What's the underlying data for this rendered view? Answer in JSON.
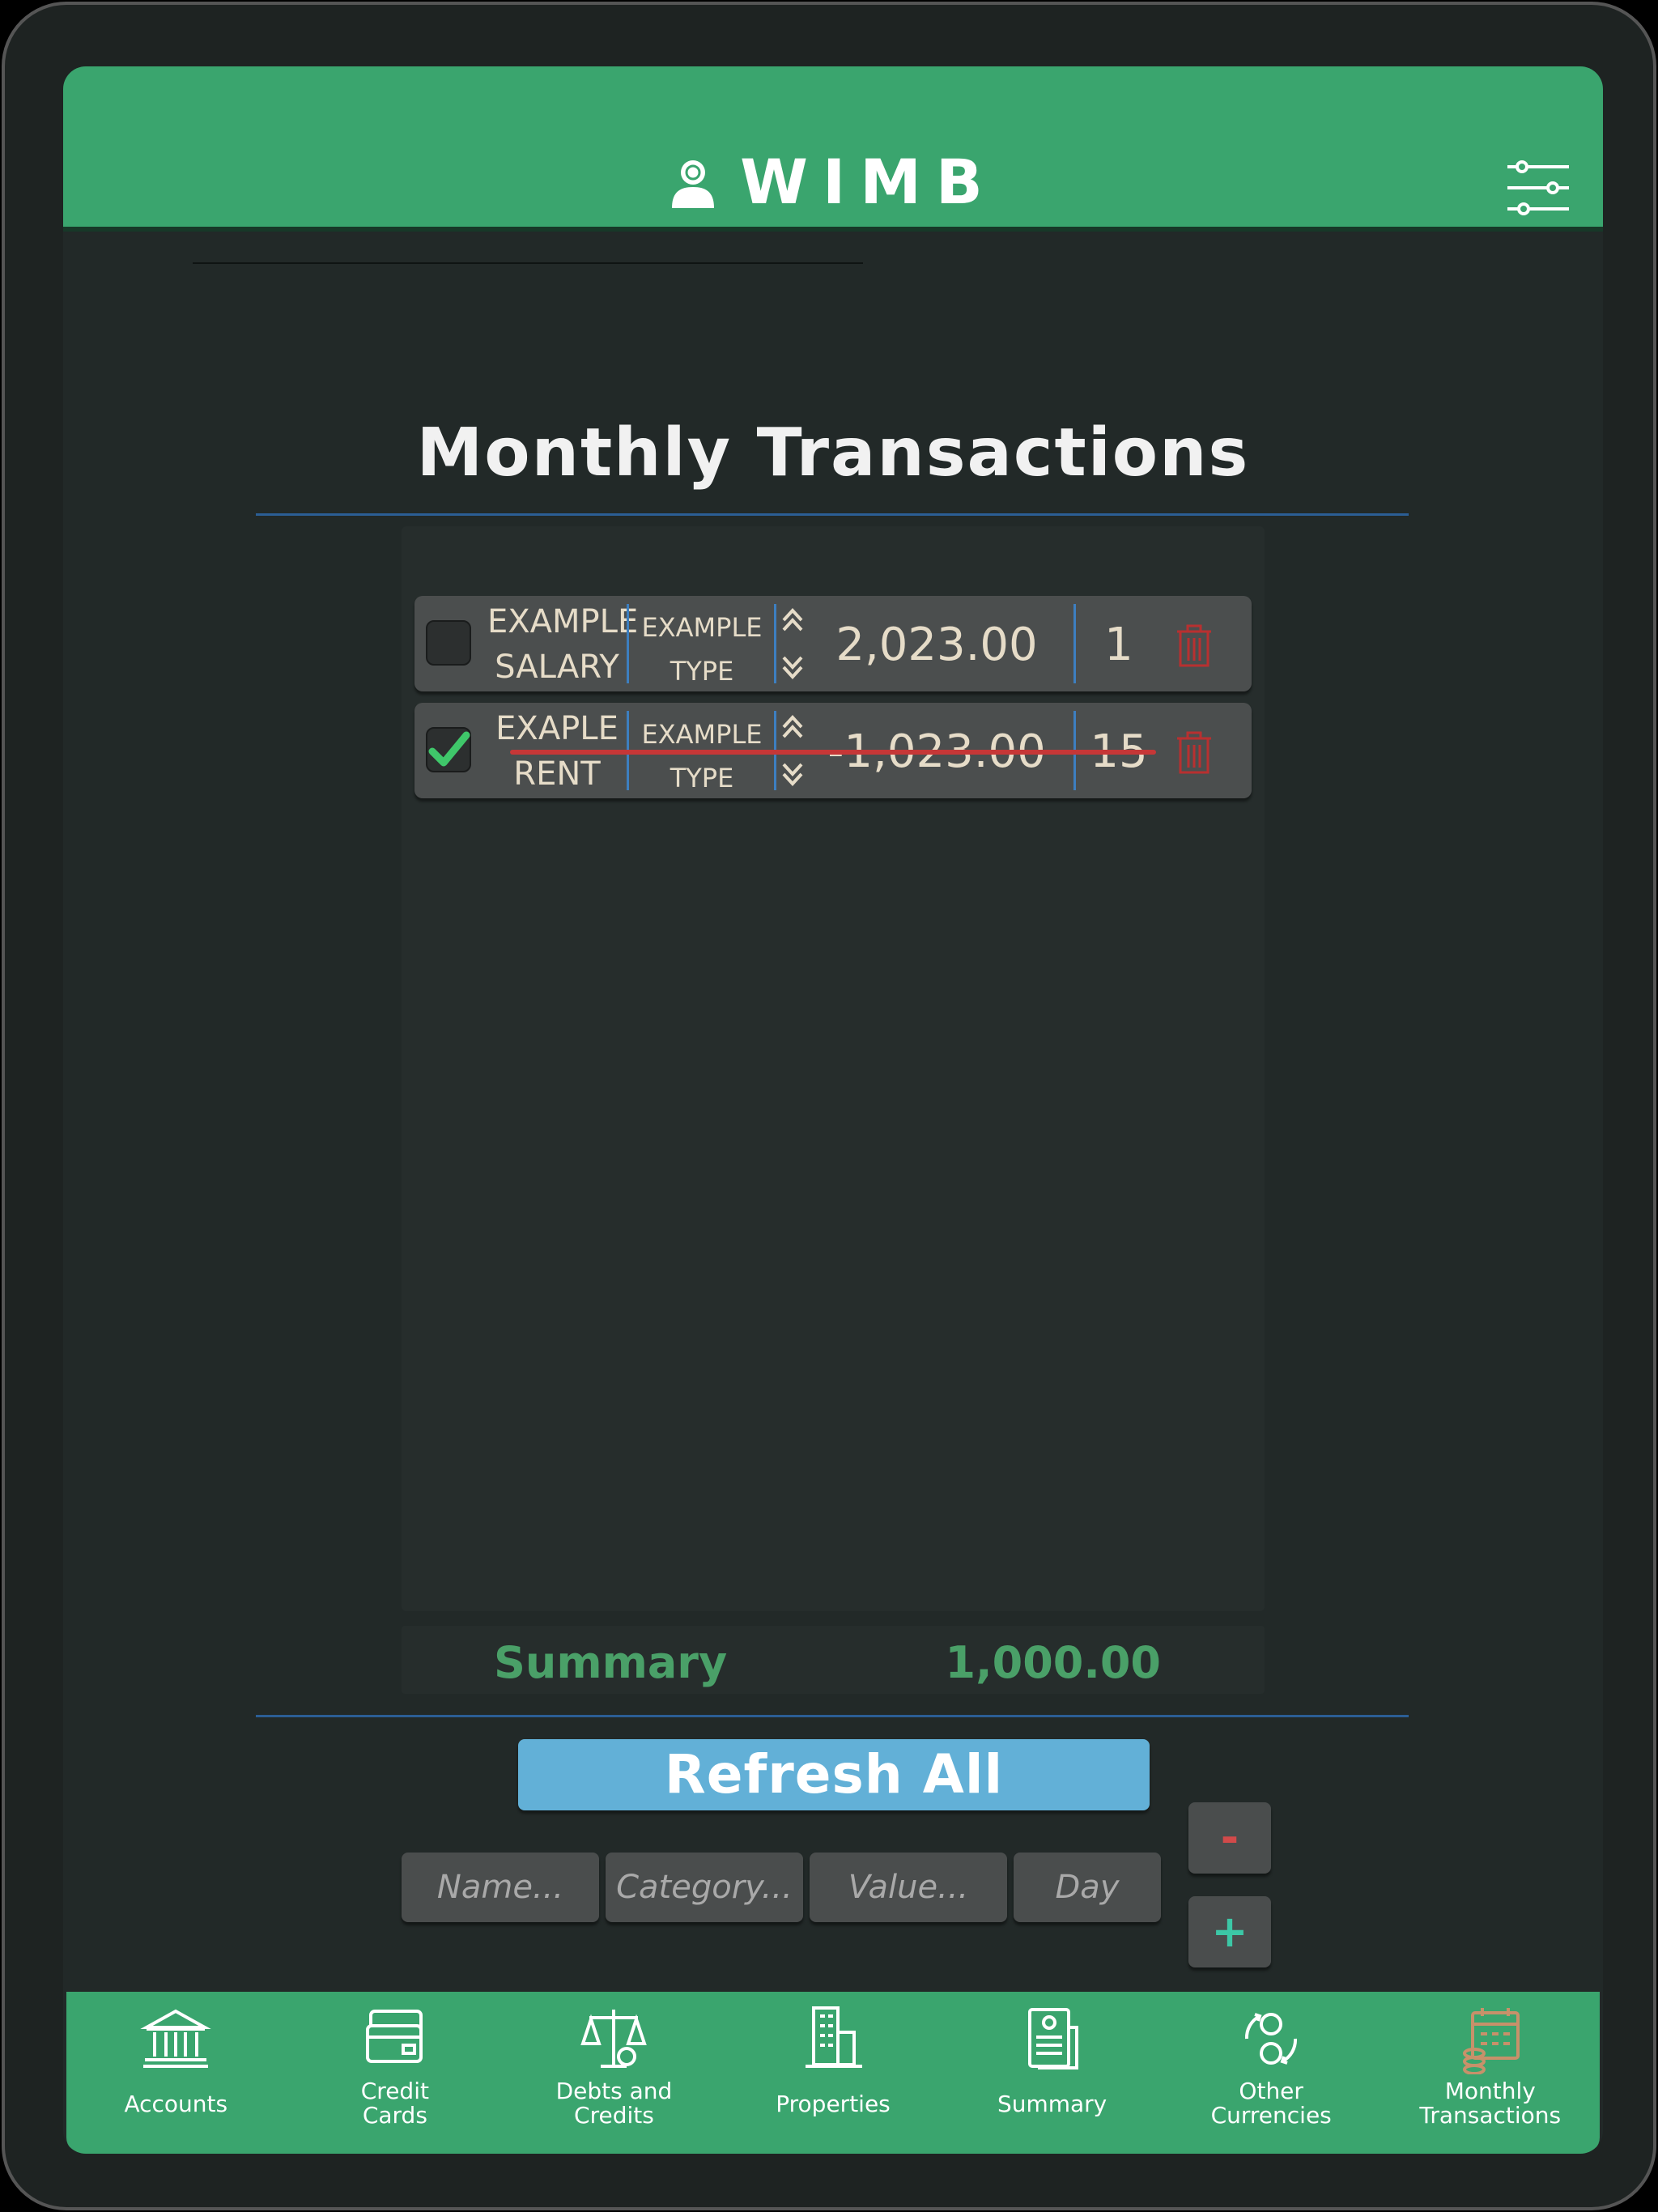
{
  "app": {
    "title": "WIMB"
  },
  "page": {
    "title": "Monthly Transactions"
  },
  "transactions": [
    {
      "name_line1": "EXAMPLE",
      "name_line2": "SALARY",
      "type_line1": "EXAMPLE",
      "type_line2": "TYPE",
      "value": "2,023.00",
      "day": "1",
      "checked": false
    },
    {
      "name_line1": "EXAPLE",
      "name_line2": "RENT",
      "type_line1": "EXAMPLE",
      "type_line2": "TYPE",
      "value": "-1,023.00",
      "day": "15",
      "checked": true
    }
  ],
  "summary": {
    "label": "Summary",
    "value": "1,000.00"
  },
  "actions": {
    "refresh_label": "Refresh All",
    "minus_label": "-",
    "plus_label": "+"
  },
  "form": {
    "name_placeholder": "Name...",
    "category_placeholder": "Category...",
    "value_placeholder": "Value...",
    "day_placeholder": "Day"
  },
  "nav": [
    {
      "label": "Accounts",
      "icon": "bank-icon",
      "active": false
    },
    {
      "label": "Credit\nCards",
      "icon": "credit-card-icon",
      "active": false
    },
    {
      "label": "Debts and\nCredits",
      "icon": "scales-icon",
      "active": false
    },
    {
      "label": "Properties",
      "icon": "buildings-icon",
      "active": false
    },
    {
      "label": "Summary",
      "icon": "document-icon",
      "active": false
    },
    {
      "label": "Other\nCurrencies",
      "icon": "currency-exchange-icon",
      "active": false
    },
    {
      "label": "Monthly\nTransactions",
      "icon": "calendar-icon",
      "active": true
    }
  ],
  "colors": {
    "header": "#3aa56e",
    "background": "#222928",
    "accent_blue": "#62b0d7",
    "summary_green": "#4aa068",
    "strike_red": "#c63737",
    "separator_blue": "#2b5e95"
  }
}
